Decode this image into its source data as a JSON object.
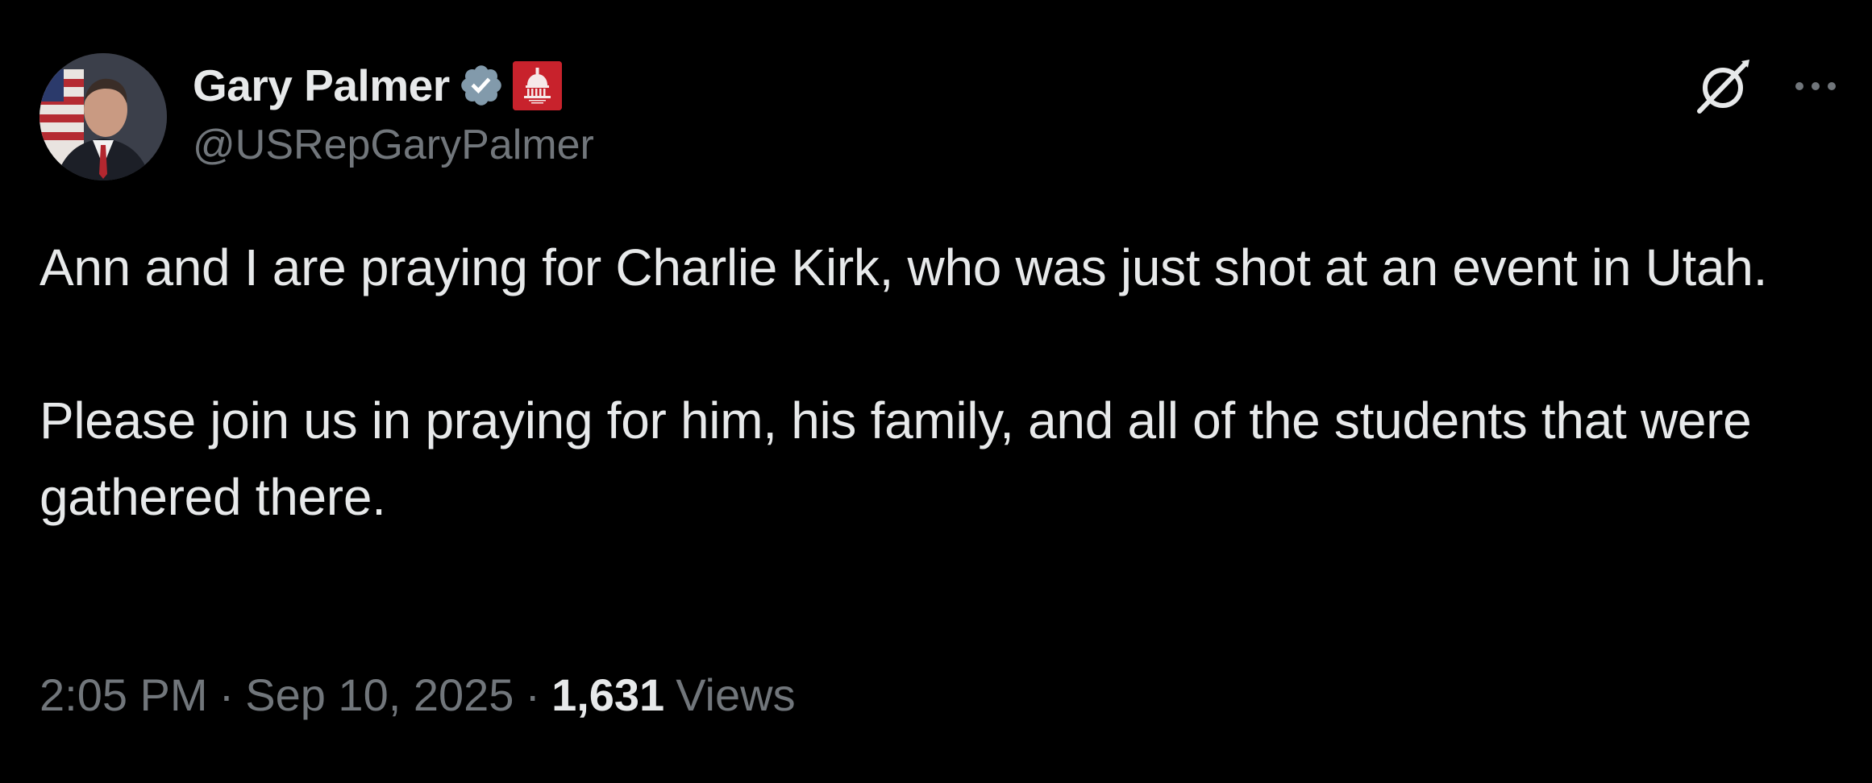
{
  "author": {
    "display_name": "Gary Palmer",
    "handle": "@USRepGaryPalmer",
    "verified_icon": "verified-badge-icon",
    "affiliation_icon": "capitol-dome-badge-icon"
  },
  "actions": {
    "grok_icon": "grok-icon",
    "more_icon": "more-options-icon"
  },
  "tweet": {
    "paragraphs": [
      "Ann and I are praying for Charlie Kirk, who was just shot at an event in Utah.",
      "Please join us in praying for him, his family, and all of the students that were gathered there."
    ]
  },
  "meta": {
    "time": "2:05 PM",
    "separator": "·",
    "date": "Sep 10, 2025",
    "views_count": "1,631",
    "views_label": "Views"
  },
  "colors": {
    "background": "#000000",
    "primary_text": "#e7e9ea",
    "secondary_text": "#71767b",
    "verified_badge": "#829aab",
    "affiliation_badge": "#c8222c"
  }
}
